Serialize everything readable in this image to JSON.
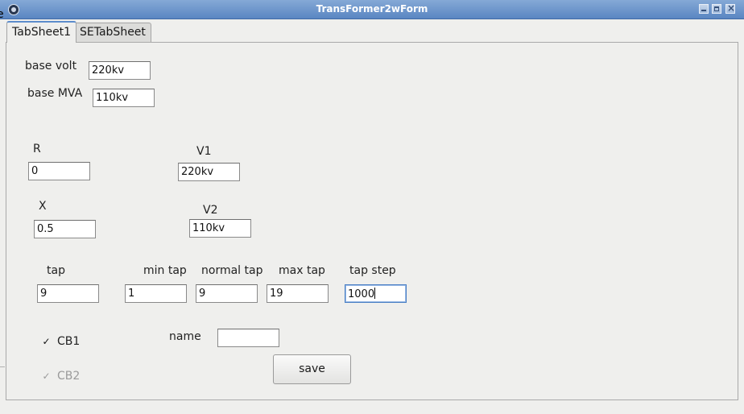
{
  "window": {
    "title": "TransFormer2wForm"
  },
  "edge_text": "e",
  "tabs": [
    {
      "label": "TabSheet1",
      "active": true
    },
    {
      "label": "SETabSheet",
      "active": false
    }
  ],
  "form": {
    "base_volt_label": "base volt",
    "base_volt_value": "220kv",
    "base_mva_label": "base MVA",
    "base_mva_value": "110kv",
    "r_label": "R",
    "r_value": "0",
    "v1_label": "V1",
    "v1_value": "220kv",
    "x_label": "X",
    "x_value": "0.5",
    "v2_label": "V2",
    "v2_value": "110kv",
    "tap_label": "tap",
    "tap_value": "9",
    "min_tap_label": "min tap",
    "min_tap_value": "1",
    "normal_tap_label": "normal tap",
    "normal_tap_value": "9",
    "max_tap_label": "max tap",
    "max_tap_value": "19",
    "tap_step_label": "tap step",
    "tap_step_value": "1000",
    "cb1_label": "CB1",
    "cb1_checked": true,
    "cb2_label": "CB2",
    "cb2_checked": true,
    "cb2_enabled": false,
    "name_label": "name",
    "name_value": "",
    "save_label": "save"
  },
  "colors": {
    "titlebar": "#5a86c2",
    "panel_bg": "#efefed",
    "focus_border": "#4a7fc4",
    "disabled_text": "#9a9a9a"
  }
}
